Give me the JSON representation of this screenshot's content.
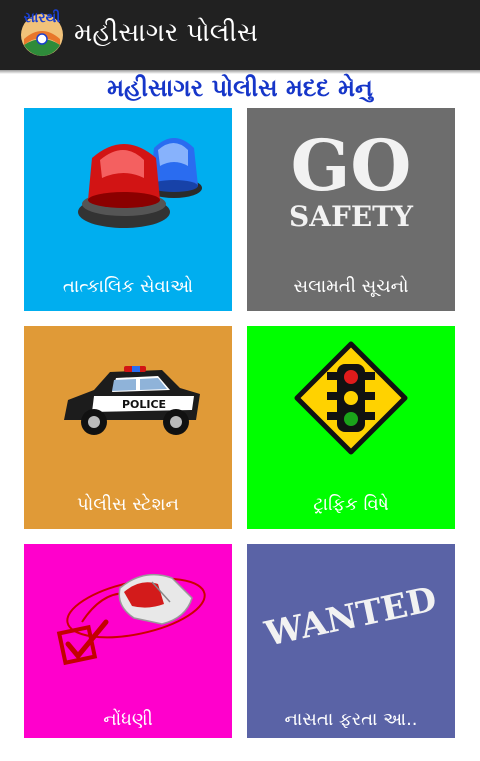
{
  "app_bar": {
    "logo_text": "સારથી",
    "title": "મહીસાગર પોલીસ"
  },
  "page_heading": "મહીસાગર પોલીસ મદદ મેનુ",
  "colors": {
    "app_bar": "#212121",
    "heading": "#1636c9",
    "tile_emergency": "#00aeef",
    "tile_safety": "#6d6d6d",
    "tile_police_station": "#e09a37",
    "tile_traffic": "#00ff00",
    "tile_registration": "#ff00cc",
    "tile_wanted": "#5a63a6"
  },
  "tiles": [
    {
      "label": "તાત્કાલિક સેવાઓ",
      "icon": "emergency-siren-icon"
    },
    {
      "label": "સલામતી સૂચનો",
      "icon": "go-safety-icon",
      "image_text": [
        "GO",
        "SAFETY"
      ]
    },
    {
      "label": "પોલીસ સ્ટેશન",
      "icon": "police-car-icon",
      "image_text": "POLICE"
    },
    {
      "label": "ટ્રાફિક વિષે",
      "icon": "traffic-light-icon"
    },
    {
      "label": "નોંધણી",
      "icon": "mouse-checkbox-icon"
    },
    {
      "label": "નાસતા ફરતા આ..",
      "icon": "wanted-stamp-icon",
      "image_text": "WANTED"
    }
  ]
}
